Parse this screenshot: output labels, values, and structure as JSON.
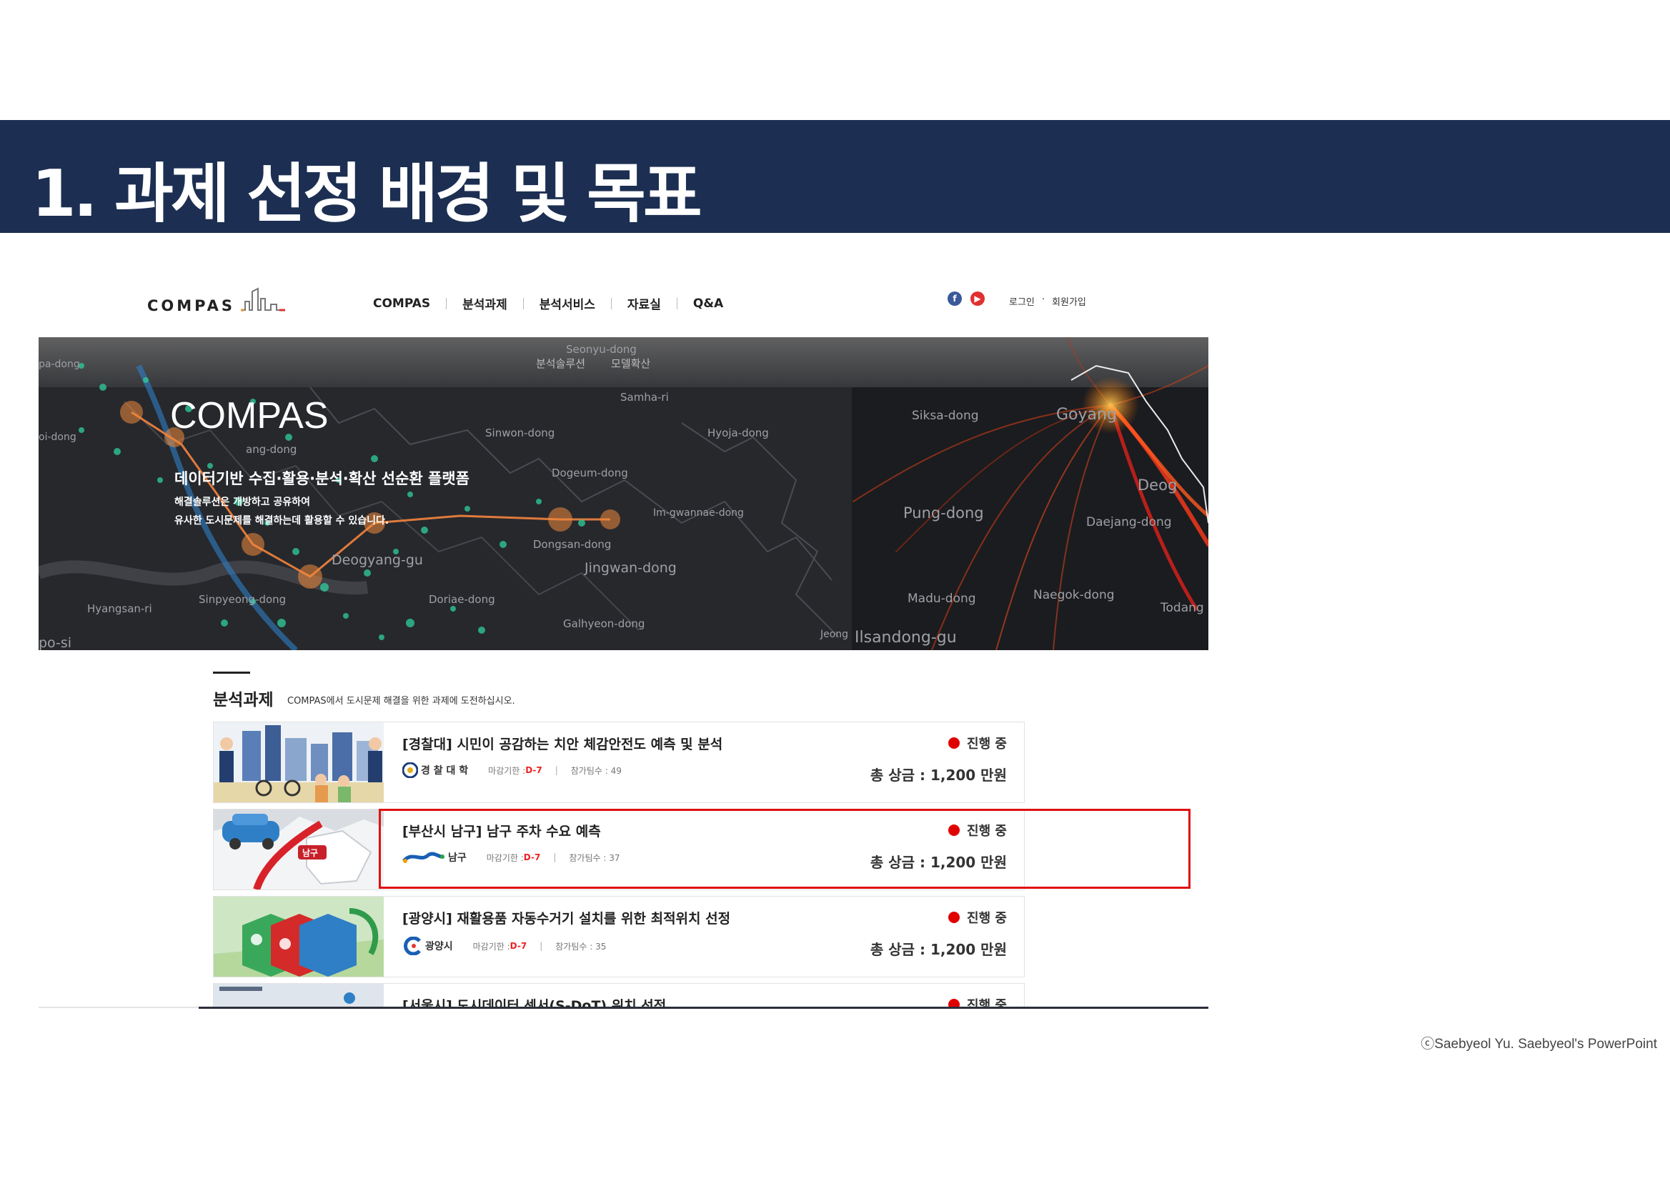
{
  "slide": {
    "title": "1. 과제 선정 배경 및 목표",
    "copyright": "ⓒSaebyeol Yu. Saebyeol's PowerPoint"
  },
  "site": {
    "logo": "COMPAS",
    "nav": [
      "COMPAS",
      "분석과제",
      "분석서비스",
      "자료실",
      "Q&A"
    ],
    "auth": {
      "login": "로그인",
      "sep": "·",
      "signup": "회원가입"
    },
    "social": [
      "facebook-icon",
      "youtube-icon"
    ]
  },
  "hero": {
    "top_links": [
      "분석솔루션",
      "모델확산"
    ],
    "title": "COMPAS",
    "subtitle": "데이터기반 수집·활용·분석·확산 선순환 플랫폼",
    "desc1": "해결솔루션은 개방하고 공유하여",
    "desc2": "유사한 도시문제를 해결하는데 활용할 수 있습니다.",
    "map_labels": [
      "Seonyu-dong",
      "Samha-ri",
      "Sinwon-dong",
      "Hyoja-dong",
      "Dogeum-dong",
      "Im-gwannae-dong",
      "Dongsan-dong",
      "Jingwan-dong",
      "Deogyang-gu",
      "Doriae-dong",
      "Sinpyeong-dong",
      "Hyangsan-ri",
      "Galhyeon-dong",
      "Siksa-dong",
      "Goyang",
      "Pung-dong",
      "Daejang-dong",
      "Madu-dong",
      "Naegok-dong",
      "Ilsandong-gu",
      "Todang",
      "Deog",
      "Jeong",
      "oi-dong",
      "pa-dong",
      "po-si",
      "ang-dong"
    ]
  },
  "section": {
    "title": "분석과제",
    "subtitle": "COMPAS에서 도시문제 해결을 위한 과제에 도전하십시오."
  },
  "tasks": [
    {
      "title": "[경찰대] 시민이 공감하는 치안 체감안전도 예측 및 분석",
      "org": "경 찰 대 학",
      "deadline_label": "마감기한 : ",
      "deadline": "D-7",
      "teams": "참가팀수 : 49",
      "status": "진행 중",
      "prize": "총 상금 : 1,200 만원"
    },
    {
      "title": "[부산시 남구] 남구 주차 수요 예측",
      "org": "남구",
      "deadline_label": "마감기한 : ",
      "deadline": "D-7",
      "teams": "참가팀수 : 37",
      "status": "진행 중",
      "prize": "총 상금 : 1,200 만원",
      "thumb_badge": "남구"
    },
    {
      "title": "[광양시] 재활용품 자동수거기 설치를 위한 최적위치 선정",
      "org": "광양시",
      "deadline_label": "마감기한 : ",
      "deadline": "D-7",
      "teams": "참가팀수 : 35",
      "status": "진행 중",
      "prize": "총 상금 : 1,200 만원"
    },
    {
      "title": "[서울시] 도시데이터 센서(S-DoT) 위치 선정",
      "status": "진행 중"
    }
  ],
  "colors": {
    "header_bg": "#1c2f52",
    "highlight": "#e01010",
    "status_dot": "#e00000",
    "d_day": "#e22222"
  }
}
